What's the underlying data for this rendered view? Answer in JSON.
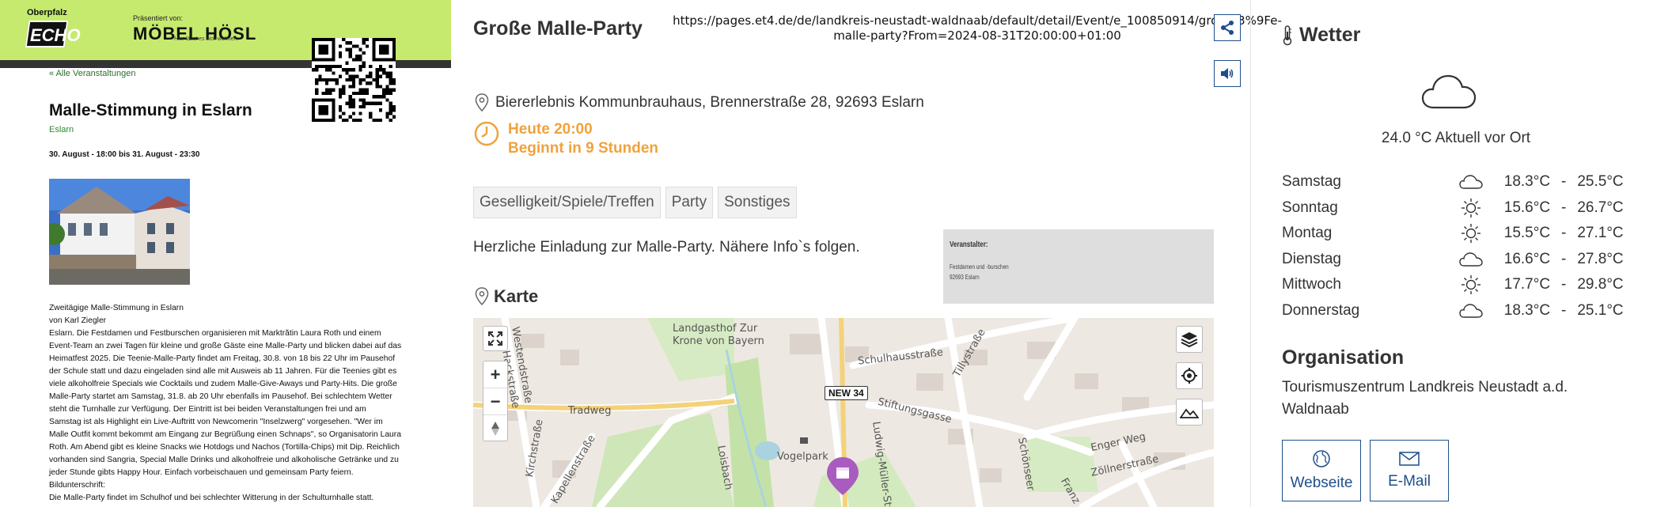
{
  "header": {
    "echo_top": "Oberpfalz",
    "echo_name": "ECHO",
    "sponsor_label": "Präsentiert von:",
    "sponsor_name": "MÖBEL HÖSL",
    "sponsor_tagline": "Hier lässt es sich wohnen."
  },
  "article": {
    "back_link": "« Alle Veranstaltungen",
    "title": "Malle-Stimmung in Eslarn",
    "place": "Eslarn",
    "dates": "30. August - 18:00 bis 31. August - 23:30",
    "body_lines": [
      "Zweitägige Malle-Stimmung in Eslarn",
      "von Karl Ziegler",
      "Eslarn. Die Festdamen und Festburschen organisieren mit Marktrătin Laura Roth und einem",
      "Event-Team an zwei Tagen für kleine und große Gäste eine Malle-Party und blicken dabei auf das",
      "Heimatfest 2025. Die Teenie-Malle-Party findet am Freitag, 30.8. von 18 bis 22 Uhr im Pausehof",
      "der Schule statt und dazu eingeladen sind alle mit Ausweis ab 11 Jahren. Für die Teenies gibt es",
      "viele alkoholfreie Specials wie Cocktails und zudem Malle-Give-Aways und Party-Hits. Die große",
      "Malle-Party startet am Samstag, 31.8. ab 20 Uhr ebenfalls im Pausehof. Bei schlechtem Wetter",
      "steht die Turnhalle zur Verfügung. Der Eintritt ist bei beiden Veranstaltungen frei und am",
      "Samstag ist als Highlight ein Live-Auftritt von Newcomerin \"Inselzwerg\" vorgesehen. \"Wer im",
      "Malle Outfit kommt bekommt am Eingang zur Begrüßung einen Schnaps\", so Organisatorin Laura",
      "Roth. Am Abend gibt es kleine Snacks wie Hotdogs und Nachos (Tortilla-Chips) mit Dip. Reichlich",
      "vorhanden sind Sangria, Special Malle Drinks und alkoholfreie und alkoholische Getränke und zu",
      "jeder Stunde gibts Happy Hour. Einfach vorbeischauen und gemeinsam Party feiern.",
      "Bildunterschrift:",
      "Die Malle-Party findet im Schulhof und bei schlechter Witterung in der Schulturnhalle statt."
    ]
  },
  "event": {
    "title": "Große Malle-Party",
    "url": "https://pages.et4.de/de/landkreis-neustadt-waldnaab/default/detail/Event/e_100850914/gro%C3%9Fe-malle-party?From=2024-08-31T20:00:00+01:00",
    "address": "Biererlebnis Kommunbrauhaus, Brennerstraße 28, 92693 Eslarn",
    "time_main": "Heute 20:00",
    "time_sub": "Beginnt in 9 Stunden",
    "tags": [
      "Geselligkeit/Spiele/Treffen",
      "Party",
      "Sonstiges"
    ],
    "description": "Herzliche Einladung zur Malle-Party. Nähere Info`s folgen.",
    "organizer_label": "Veranstalter:",
    "organizer_line1": "Festdamen und -burschen",
    "organizer_line2": "92693 Eslarn",
    "map_heading": "Karte",
    "map_labels": {
      "landgasthof": "Landgasthof Zur",
      "landgasthof2": "Krone von Bayern",
      "road_badge": "NEW 34",
      "schulhausstrasse": "Schulhausstraße",
      "stiftungsgasse": "Stiftungsgasse",
      "tradweg": "Tradweg",
      "vogelpark": "Vogelpark",
      "engerweg": "Enger Weg",
      "zoellnerstrasse": "Zöllnerstraße",
      "kapellenstrasse": "Kapellenstraße",
      "westendstrasse": "Westendstraße",
      "ludwig": "Ludwig-Müller-Straße",
      "tillystrasse": "Tillystraße",
      "loisbach": "Loisbach",
      "schoenseer": "Schönseer",
      "franz": "Franz",
      "kirchstrasse": "Kirchstraße",
      "hackstrasse": "Hackstraße"
    }
  },
  "weather": {
    "title": "Wetter",
    "current": "24.0 °C Aktuell vor Ort",
    "forecast": [
      {
        "day": "Samstag",
        "icon": "cloud-icon",
        "min": "18.3°C",
        "max": "25.5°C"
      },
      {
        "day": "Sonntag",
        "icon": "sun-icon",
        "min": "15.6°C",
        "max": "26.7°C"
      },
      {
        "day": "Montag",
        "icon": "sun-icon",
        "min": "15.5°C",
        "max": "27.1°C"
      },
      {
        "day": "Dienstag",
        "icon": "cloud-icon",
        "min": "16.6°C",
        "max": "27.8°C"
      },
      {
        "day": "Mittwoch",
        "icon": "sun-icon",
        "min": "17.7°C",
        "max": "29.8°C"
      },
      {
        "day": "Donnerstag",
        "icon": "cloud-icon",
        "min": "18.3°C",
        "max": "25.1°C"
      }
    ],
    "separator": "-"
  },
  "organisation": {
    "title": "Organisation",
    "name": "Tourismuszentrum Landkreis Neustadt a.d. Waldnaab",
    "web_label": "Webseite",
    "mail_label": "E-Mail"
  },
  "colors": {
    "banner": "#c6ea6e",
    "accent_blue": "#1e4f8a",
    "time_orange": "#f0a23c",
    "pin_purple": "#a95cc0"
  }
}
